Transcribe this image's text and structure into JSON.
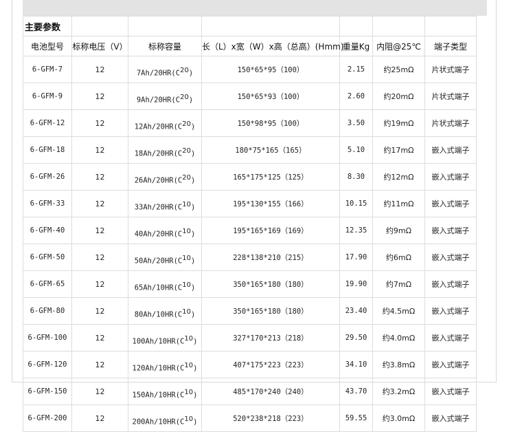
{
  "section_title": "主要参数",
  "headers": [
    "电池型号",
    "标称电压（V）",
    "标称容量",
    "长（L）x宽（W）x高（总高）(Hmm)",
    "重量Kg",
    "内阻@25℃",
    "端子类型"
  ],
  "rows": [
    {
      "model": "6-GFM-7",
      "voltage": "12",
      "cap_base": "7Ah/20HR(C",
      "cap_sup": "20",
      "cap_close": ")",
      "dims": "150*65*95（100）",
      "weight": "2.15",
      "resistance": "约25mΩ",
      "terminal": "片状式端子"
    },
    {
      "model": "6-GFM-9",
      "voltage": "12",
      "cap_base": "9Ah/20HR(C",
      "cap_sup": "20",
      "cap_close": ")",
      "dims": "150*65*93（100）",
      "weight": "2.60",
      "resistance": "约20mΩ",
      "terminal": "片状式端子"
    },
    {
      "model": "6-GFM-12",
      "voltage": "12",
      "cap_base": "12Ah/20HR(C",
      "cap_sup": "20",
      "cap_close": ")",
      "dims": "150*98*95（100）",
      "weight": "3.50",
      "resistance": "约19mΩ",
      "terminal": "片状式端子"
    },
    {
      "model": "6-GFM-18",
      "voltage": "12",
      "cap_base": "18Ah/20HR(C",
      "cap_sup": "20",
      "cap_close": ")",
      "dims": "180*75*165（165）",
      "weight": "5.10",
      "resistance": "约17mΩ",
      "terminal": "嵌入式端子"
    },
    {
      "model": "6-GFM-26",
      "voltage": "12",
      "cap_base": "26Ah/20HR(C",
      "cap_sup": "20",
      "cap_close": ")",
      "dims": "165*175*125（125）",
      "weight": "8.30",
      "resistance": "约12mΩ",
      "terminal": "嵌入式端子"
    },
    {
      "model": "6-GFM-33",
      "voltage": "12",
      "cap_base": "33Ah/20HR(C",
      "cap_sup": "10",
      "cap_close": ")",
      "dims": "195*130*155（166）",
      "weight": "10.15",
      "resistance": "约11mΩ",
      "terminal": "嵌入式端子"
    },
    {
      "model": "6-GFM-40",
      "voltage": "12",
      "cap_base": "40Ah/20HR(C",
      "cap_sup": "10",
      "cap_close": ")",
      "dims": "195*165*169（169）",
      "weight": "12.35",
      "resistance": "约9mΩ",
      "terminal": "嵌入式端子"
    },
    {
      "model": "6-GFM-50",
      "voltage": "12",
      "cap_base": "50Ah/20HR(C",
      "cap_sup": "10",
      "cap_close": ")",
      "dims": "228*138*210（215）",
      "weight": "17.90",
      "resistance": "约6mΩ",
      "terminal": "嵌入式端子"
    },
    {
      "model": "6-GFM-65",
      "voltage": "12",
      "cap_base": "65Ah/10HR(C",
      "cap_sup": "10",
      "cap_close": ")",
      "dims": "350*165*180（180）",
      "weight": "19.90",
      "resistance": "约7mΩ",
      "terminal": "嵌入式端子"
    },
    {
      "model": "6-GFM-80",
      "voltage": "12",
      "cap_base": "80Ah/10HR(C",
      "cap_sup": "10",
      "cap_close": ")",
      "dims": "350*165*180（180）",
      "weight": "23.40",
      "resistance": "约4.5mΩ",
      "terminal": "嵌入式端子"
    },
    {
      "model": "6-GFM-100",
      "voltage": "12",
      "cap_base": "100Ah/10HR(C",
      "cap_sup": "10",
      "cap_close": ")",
      "dims": "327*170*213（218）",
      "weight": "29.50",
      "resistance": "约4.0mΩ",
      "terminal": "嵌入式端子"
    },
    {
      "model": "6-GFM-120",
      "voltage": "12",
      "cap_base": "120Ah/10HR(C",
      "cap_sup": "10",
      "cap_close": ")",
      "dims": "407*175*223（223）",
      "weight": "34.10",
      "resistance": "约3.8mΩ",
      "terminal": "嵌入式端子"
    },
    {
      "model": "6-GFM-150",
      "voltage": "12",
      "cap_base": "150Ah/10HR(C",
      "cap_sup": "10",
      "cap_close": ")",
      "dims": "485*170*240（240）",
      "weight": "43.70",
      "resistance": "约3.2mΩ",
      "terminal": "嵌入式端子"
    },
    {
      "model": "6-GFM-200",
      "voltage": "12",
      "cap_base": "200Ah/10HR(C",
      "cap_sup": "10",
      "cap_close": ")",
      "dims": "520*238*218（223）",
      "weight": "59.55",
      "resistance": "约3.0mΩ",
      "terminal": "嵌入式端子"
    }
  ]
}
